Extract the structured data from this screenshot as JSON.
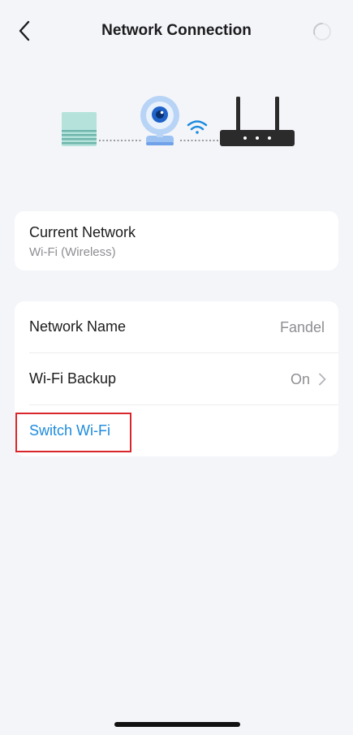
{
  "header": {
    "title": "Network Connection"
  },
  "current_network": {
    "title": "Current Network",
    "subtitle": "Wi-Fi (Wireless)"
  },
  "settings": {
    "network_name_label": "Network Name",
    "network_name_value": "Fandel",
    "wifi_backup_label": "Wi-Fi Backup",
    "wifi_backup_value": "On",
    "switch_wifi_label": "Switch Wi-Fi"
  },
  "colors": {
    "accent": "#1d8bdd",
    "highlight": "#d9262c",
    "background": "#f4f5f9"
  }
}
